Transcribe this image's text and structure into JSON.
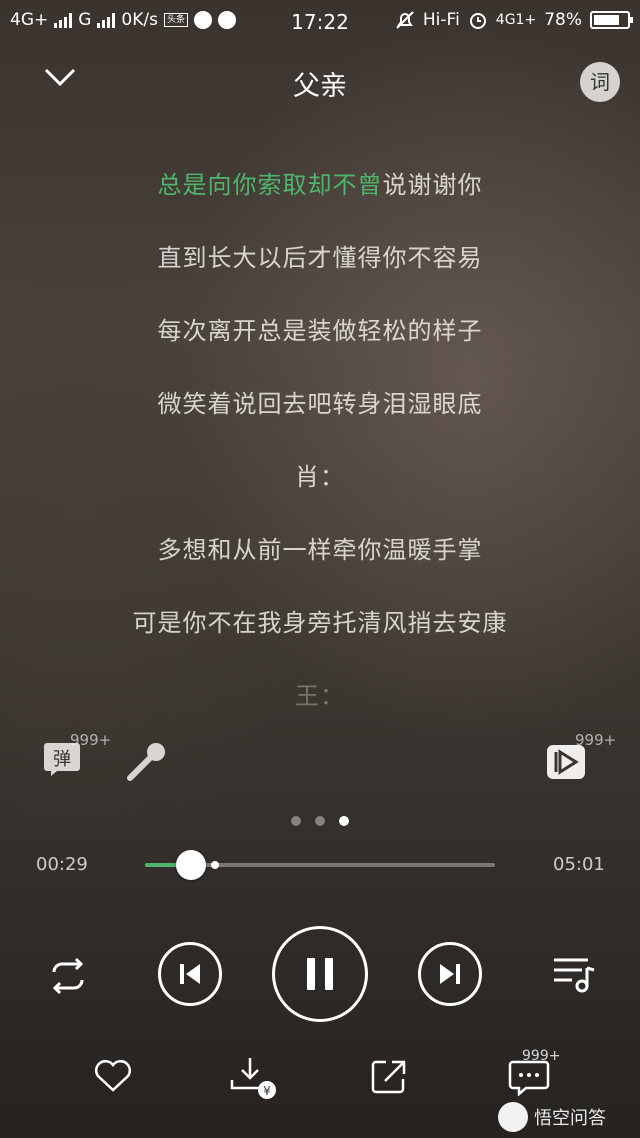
{
  "status_bar": {
    "network1": "4G+",
    "network2": "G",
    "speed": "0K/s",
    "app_badge": "头条",
    "time": "17:22",
    "hifi": "Hi-Fi",
    "network3": "4G1+",
    "battery_percent": "78%",
    "battery_level": 0.78
  },
  "header": {
    "title": "父亲",
    "lyrics_button_label": "词"
  },
  "lyrics": [
    {
      "sung": "总是向你索取却不曾",
      "unsung": "说谢谢你"
    },
    {
      "sung": "",
      "unsung": "直到长大以后才懂得你不容易"
    },
    {
      "sung": "",
      "unsung": "每次离开总是装做轻松的样子"
    },
    {
      "sung": "",
      "unsung": "微笑着说回去吧转身泪湿眼底"
    },
    {
      "sung": "",
      "unsung": "肖："
    },
    {
      "sung": "",
      "unsung": "多想和从前一样牵你温暖手掌"
    },
    {
      "sung": "",
      "unsung": "可是你不在我身旁托清风捎去安康"
    },
    {
      "sung": "",
      "unsung": "王："
    }
  ],
  "mid_actions": {
    "danmu_label": "弹",
    "danmu_count": "999+",
    "video_count": "999+"
  },
  "player": {
    "elapsed": "00:29",
    "total": "05:01",
    "played_fraction": 0.13,
    "buffered_fraction": 0.2,
    "accent_color": "#4fb56c"
  },
  "pager": {
    "count": 3,
    "active": 2
  },
  "bottom": {
    "comment_count": "999+",
    "watermark": "悟空问答"
  }
}
